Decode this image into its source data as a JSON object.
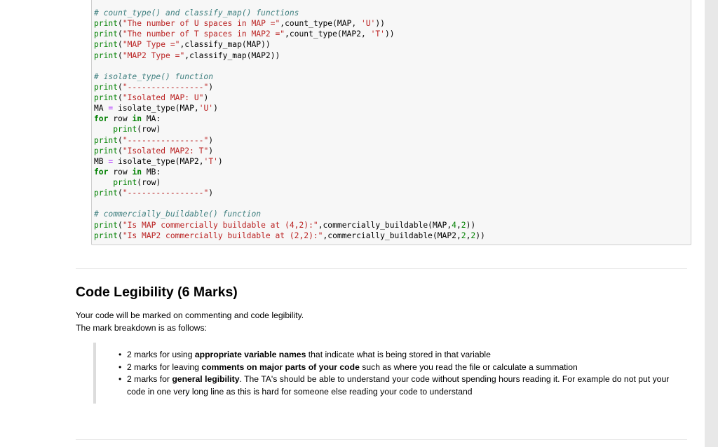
{
  "code_cell": {
    "lines": [
      "# count_type() and classify_map() functions",
      "print(\"The number of U spaces in MAP =\",count_type(MAP, 'U'))",
      "print(\"The number of T spaces in MAP2 =\",count_type(MAP2, 'T'))",
      "print(\"MAP Type =\",classify_map(MAP))",
      "print(\"MAP2 Type =\",classify_map(MAP2))",
      "",
      "# isolate_type() function",
      "print(\"----------------\")",
      "print(\"Isolated MAP: U\")",
      "MA = isolate_type(MAP,'U')",
      "for row in MA:",
      "    print(row)",
      "print(\"----------------\")",
      "print(\"Isolated MAP2: T\")",
      "MB = isolate_type(MAP2,'T')",
      "for row in MB:",
      "    print(row)",
      "print(\"----------------\")",
      "",
      "# commercially_buildable() function",
      "print(\"Is MAP commercially buildable at (4,2):\",commercially_buildable(MAP,4,2))",
      "print(\"Is MAP2 commercially buildable at (2,2):\",commercially_buildable(MAP2,2,2))"
    ]
  },
  "section": {
    "title": "Code Legibility (6 Marks)",
    "intro_line1": "Your code will be marked on commenting and code legibility.",
    "intro_line2": "The mark breakdown is as follows:",
    "bullets": [
      {
        "pre": "2 marks for using ",
        "bold": "appropriate variable names",
        "post": " that indicate what is being stored in that variable"
      },
      {
        "pre": "2 marks for leaving ",
        "bold": "comments on major parts of your code",
        "post": " such as where you read the file or calculate a summation"
      },
      {
        "pre": "2 marks for ",
        "bold": "general legibility",
        "post": ". The TA's should be able to understand your code without spending hours reading it. For example do not put your code in one very long line as this is hard for someone else reading your code to understand"
      }
    ]
  }
}
